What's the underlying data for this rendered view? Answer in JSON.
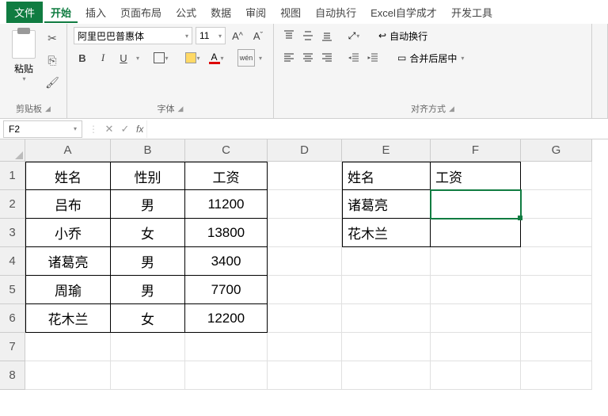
{
  "menu": {
    "file": "文件",
    "home": "开始",
    "insert": "插入",
    "layout": "页面布局",
    "formula": "公式",
    "data": "数据",
    "review": "审阅",
    "view": "视图",
    "automate": "自动执行",
    "excel_self": "Excel自学成才",
    "dev": "开发工具"
  },
  "ribbon": {
    "clipboard": {
      "paste": "粘贴",
      "label": "剪贴板"
    },
    "font": {
      "name": "阿里巴巴普惠体",
      "size": "11",
      "increase": "A^",
      "decrease": "A˅",
      "bold": "B",
      "italic": "I",
      "underline": "U",
      "color_letter": "A",
      "wen": "wén",
      "label": "字体"
    },
    "align": {
      "wrap": "自动换行",
      "merge": "合并后居中",
      "label": "对齐方式"
    }
  },
  "fbar": {
    "namebox": "F2",
    "fx": "fx"
  },
  "grid": {
    "cols": [
      "A",
      "B",
      "C",
      "D",
      "E",
      "F",
      "G"
    ],
    "rows": [
      "1",
      "2",
      "3",
      "4",
      "5",
      "6",
      "7",
      "8"
    ],
    "table1": {
      "h": [
        "姓名",
        "性别",
        "工资"
      ],
      "r": [
        [
          "吕布",
          "男",
          "11200"
        ],
        [
          "小乔",
          "女",
          "13800"
        ],
        [
          "诸葛亮",
          "男",
          "3400"
        ],
        [
          "周瑜",
          "男",
          "7700"
        ],
        [
          "花木兰",
          "女",
          "12200"
        ]
      ]
    },
    "table2": {
      "h": [
        "姓名",
        "工资"
      ],
      "r": [
        [
          "诸葛亮",
          ""
        ],
        [
          "花木兰",
          ""
        ]
      ]
    }
  }
}
